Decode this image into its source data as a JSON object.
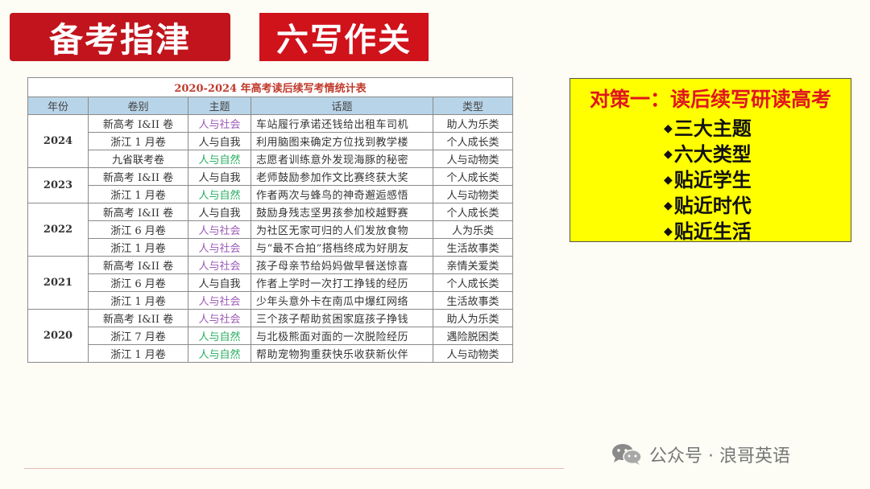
{
  "header": {
    "title": "备考指津",
    "subtitle": "六写作关"
  },
  "table": {
    "caption": "2020-2024 年高考读后续写考情统计表",
    "columns": [
      "年份",
      "卷别",
      "主题",
      "话题",
      "类型"
    ],
    "groups": [
      {
        "year": "2024",
        "rows": [
          {
            "paper": "新高考 I&II 卷",
            "theme": "人与社会",
            "topic": "车站履行承诺还钱给出租车司机",
            "type": "助人为乐类",
            "theme_class": "social"
          },
          {
            "paper": "浙江 1 月卷",
            "theme": "人与自我",
            "topic": "利用脑图来确定方位找到教学楼",
            "type": "个人成长类",
            "theme_class": "self"
          },
          {
            "paper": "九省联考卷",
            "theme": "人与自然",
            "topic": "志愿者训练意外发现海豚的秘密",
            "type": "人与动物类",
            "theme_class": "nature"
          }
        ]
      },
      {
        "year": "2023",
        "rows": [
          {
            "paper": "新高考 I&II 卷",
            "theme": "人与自我",
            "topic": "老师鼓励参加作文比赛终获大奖",
            "type": "个人成长类",
            "theme_class": "self"
          },
          {
            "paper": "浙江 1 月卷",
            "theme": "人与自然",
            "topic": "作者两次与蜂鸟的神奇邂逅感悟",
            "type": "人与动物类",
            "theme_class": "nature"
          }
        ]
      },
      {
        "year": "2022",
        "rows": [
          {
            "paper": "新高考 I&II 卷",
            "theme": "人与自我",
            "topic": "鼓励身残志坚男孩参加校越野赛",
            "type": "个人成长类",
            "theme_class": "self"
          },
          {
            "paper": "浙江 6 月卷",
            "theme": "人与社会",
            "topic": "为社区无家可归的人们发放食物",
            "type": "人为乐类",
            "theme_class": "social"
          },
          {
            "paper": "浙江 1 月卷",
            "theme": "人与社会",
            "topic": "与“最不合拍”搭档终成为好朋友",
            "type": "生活故事类",
            "theme_class": "social"
          }
        ]
      },
      {
        "year": "2021",
        "rows": [
          {
            "paper": "新高考 I&II 卷",
            "theme": "人与社会",
            "topic": "孩子母亲节给妈妈做早餐送惊喜",
            "type": "亲情关爱类",
            "theme_class": "social"
          },
          {
            "paper": "浙江 6 月卷",
            "theme": "人与自我",
            "topic": "作者上学时一次打工挣钱的经历",
            "type": "个人成长类",
            "theme_class": "self"
          },
          {
            "paper": "浙江 1 月卷",
            "theme": "人与社会",
            "topic": "少年头意外卡在南瓜中爆红网络",
            "type": "生活故事类",
            "theme_class": "social"
          }
        ]
      },
      {
        "year": "2020",
        "rows": [
          {
            "paper": "新高考 I&II 卷",
            "theme": "人与社会",
            "topic": "三个孩子帮助贫困家庭孩子挣钱",
            "type": "助人为乐类",
            "theme_class": "social"
          },
          {
            "paper": "浙江 7 月卷",
            "theme": "人与自然",
            "topic": "与北极熊面对面的一次脱险经历",
            "type": "遇险脱困类",
            "theme_class": "nature"
          },
          {
            "paper": "浙江 1 月卷",
            "theme": "人与自然",
            "topic": "帮助宠物狗重获快乐收获新伙伴",
            "type": "人与动物类",
            "theme_class": "nature"
          }
        ]
      }
    ]
  },
  "strategy": {
    "title": "对策一：读后续写研读高考",
    "items": [
      "三大主题",
      "六大类型",
      "贴近学生",
      "贴近时代",
      "贴近生活"
    ],
    "bullet": "◆"
  },
  "watermark": {
    "text": "公众号 · 浪哥英语",
    "icon": "wechat-icon"
  },
  "colors": {
    "title_bg": "#c1141c",
    "strategy_bg": "#ffff00",
    "strategy_title": "#e0161e",
    "header_row": "#b8d4e8",
    "year_cell": "#fbe5d6",
    "theme_social": "#9b59b6",
    "theme_nature": "#27ae60"
  }
}
